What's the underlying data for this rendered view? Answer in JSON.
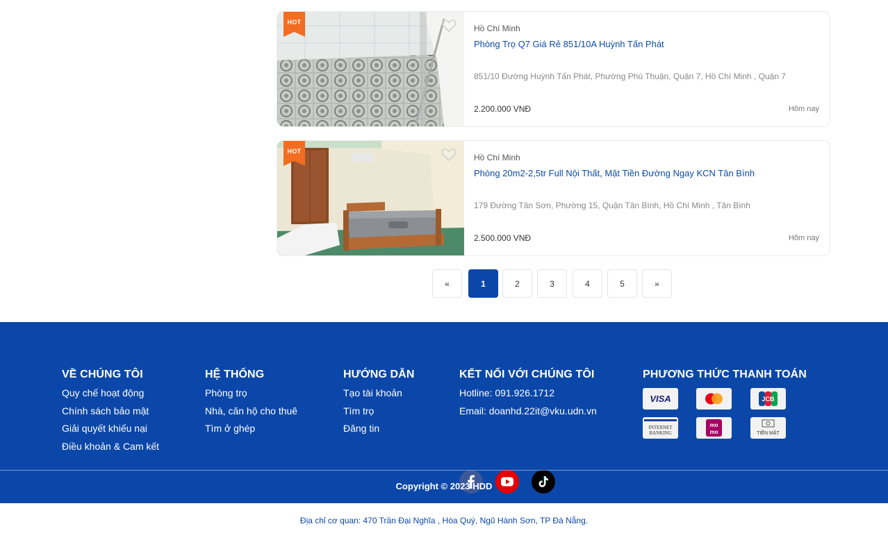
{
  "listings": [
    {
      "badge": "HOT",
      "city": "Hồ Chí Minh",
      "title": "Phòng Trọ Q7 Giá Rẻ 851/10A Huỳnh Tấn Phát",
      "address": "851/10 Đường Huỳnh Tấn Phát, Phường Phú Thuận, Quận 7, Hồ Chí Minh , Quận 7",
      "price": "2.200.000 VNĐ",
      "date": "Hôm nay"
    },
    {
      "badge": "HOT",
      "city": "Hồ Chí Minh",
      "title": "Phòng 20m2-2,5tr Full Nội Thất, Mặt Tiền Đường Ngay KCN Tân Bình",
      "address": "179 Đường Tân Sơn, Phường 15, Quận Tân Bình, Hồ Chí Minh , Tân Bình",
      "price": "2.500.000 VNĐ",
      "date": "Hôm nay"
    }
  ],
  "pagination": {
    "prev": "«",
    "pages": [
      "1",
      "2",
      "3",
      "4",
      "5"
    ],
    "current": "1",
    "next": "»"
  },
  "footer": {
    "about": {
      "heading": "VỀ CHÚNG TÔI",
      "links": [
        "Quy chế hoạt động",
        "Chính sách bảo mật",
        "Giải quyết khiếu nại",
        "Điều khoản & Cam kết"
      ]
    },
    "system": {
      "heading": "HỆ THỐNG",
      "links": [
        "Phòng trọ",
        "Nhà, căn hộ cho thuê",
        "Tìm ở ghép"
      ]
    },
    "guide": {
      "heading": "HƯỚNG DẪN",
      "links": [
        "Tạo tài khoản",
        "Tìm trọ",
        "Đăng tin"
      ]
    },
    "connect": {
      "heading": "KẾT NỐI VỚI CHÚNG TÔI",
      "hotline": "Hotline: 091.926.1712",
      "email": "Email: doanhd.22it@vku.udn.vn",
      "socials": [
        "facebook-icon",
        "youtube-icon",
        "tiktok-icon"
      ]
    },
    "payment": {
      "heading": "PHƯƠNG THỨC THANH TOÁN",
      "methods": [
        "VISA",
        "mastercard",
        "JCB",
        "INTERNET BANKING",
        "mo mo",
        "TIỀN MẶT"
      ]
    },
    "copyright": "Copyright © 2023 HDD"
  },
  "office_address": "Địa chỉ cơ quan: 470 Trần Đại Nghĩa , Hòa Quý, Ngũ Hành Sơn, TP Đà Nẵng.",
  "colors": {
    "primary": "#0b47a8",
    "hot_badge": "#f26d21",
    "link": "#0b4ba7"
  }
}
